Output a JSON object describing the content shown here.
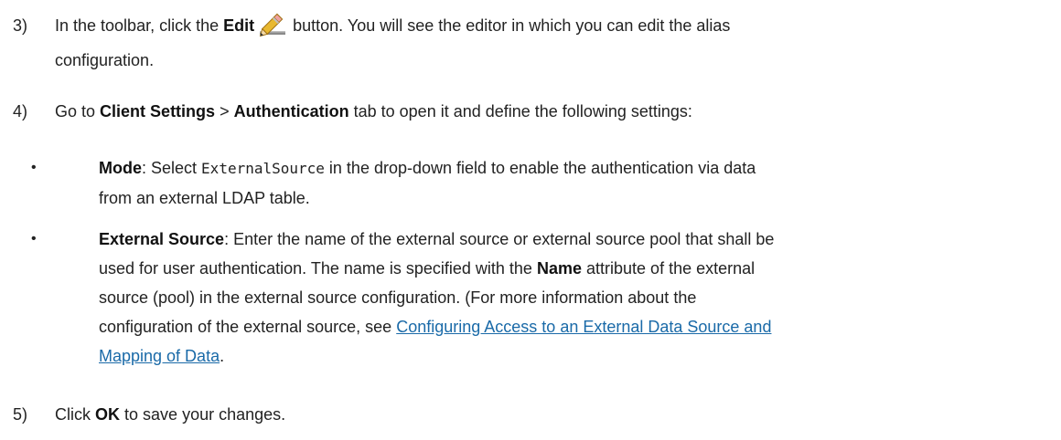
{
  "step3": {
    "number": "3)",
    "part1": "In the toolbar, click the",
    "edit": "Edit",
    "part2": "button. You will see the editor in which you can edit the alias",
    "part3": "configuration.",
    "icon": "pencil-edit-icon"
  },
  "step4": {
    "number": "4)",
    "part1": "Go to",
    "client_settings": "Client Settings",
    "sep": ">",
    "authentication": "Authentication",
    "part2": "tab to open it and define the following settings:"
  },
  "bullet1": {
    "label": "Mode",
    "part1": ": Select",
    "code": "ExternalSource",
    "part2": "in the drop-down field to enable the authentication via data",
    "part3": "from an external LDAP table."
  },
  "bullet2": {
    "label": "External Source",
    "line1": ": Enter the name of the external source or external source pool that shall be",
    "line2a": "used for user authentication. The name is specified with the",
    "name": "Name",
    "line2b": "attribute of the external",
    "line3": "source (pool) in the external source configuration. (For more information about the",
    "line4": "configuration of the external source, see",
    "link_line1": "Configuring Access to an External Data Source and",
    "link_line2": "Mapping of Data",
    "end": "."
  },
  "step5": {
    "number": "5)",
    "part1": "Click",
    "ok": "OK",
    "part2": "to save your changes."
  },
  "bullet_glyph": "•"
}
